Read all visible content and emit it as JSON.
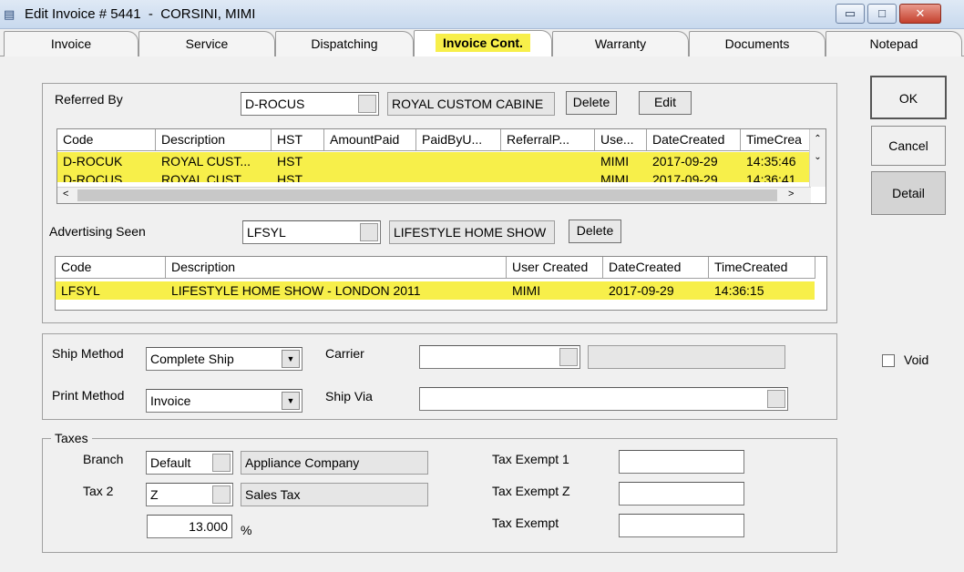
{
  "window": {
    "title": "Edit Invoice # 5441  -  CORSINI, MIMI",
    "min_glyph": "▭",
    "max_glyph": "□",
    "close_glyph": "✕"
  },
  "tabs": [
    "Invoice",
    "Service",
    "Dispatching",
    "Invoice Cont.",
    "Warranty",
    "Documents",
    "Notepad"
  ],
  "referred_by": {
    "label": "Referred By",
    "code": "D-ROCUS",
    "description": "ROYAL CUSTOM CABINE",
    "delete_label": "Delete",
    "edit_label": "Edit",
    "columns": [
      "Code",
      "Description",
      "HST",
      "AmountPaid",
      "PaidByU...",
      "ReferralP...",
      "Use...",
      "DateCreated",
      "TimeCrea"
    ],
    "rows": [
      {
        "code": "D-ROCUK",
        "description": "ROYAL CUST...",
        "hst": "HST",
        "user": "MIMI",
        "date": "2017-09-29",
        "time": "14:35:46"
      },
      {
        "code": "D-ROCUS",
        "description": "ROYAL CUST...",
        "hst": "HST",
        "user": "MIMI",
        "date": "2017-09-29",
        "time": "14:36:41"
      }
    ]
  },
  "advertising": {
    "label": "Advertising Seen",
    "code": "LFSYL",
    "description": "LIFESTYLE HOME SHOW",
    "delete_label": "Delete",
    "columns": [
      "Code",
      "Description",
      "User Created",
      "DateCreated",
      "TimeCreated"
    ],
    "rows": [
      {
        "code": "LFSYL",
        "description": "LIFESTYLE HOME SHOW - LONDON 2011",
        "user": "MIMI",
        "date": "2017-09-29",
        "time": "14:36:15"
      }
    ]
  },
  "shipping": {
    "ship_method_label": "Ship Method",
    "ship_method_value": "Complete Ship",
    "carrier_label": "Carrier",
    "carrier_value": "",
    "print_method_label": "Print Method",
    "print_method_value": "Invoice",
    "ship_via_label": "Ship Via",
    "ship_via_value": ""
  },
  "taxes": {
    "legend": "Taxes",
    "branch_label": "Branch",
    "branch_value": "Default",
    "branch_desc": "Appliance Company",
    "tax2_label": "Tax 2",
    "tax2_value": "Z",
    "tax2_desc": "Sales Tax",
    "rate_value": "13.000",
    "percent_sign": "%",
    "exempt1_label": "Tax Exempt 1",
    "exempt1_value": "",
    "exemptz_label": "Tax Exempt Z",
    "exemptz_value": "",
    "exempt_label": "Tax Exempt",
    "exempt_value": ""
  },
  "actions": {
    "ok_label": "OK",
    "cancel_label": "Cancel",
    "detail_label": "Detail",
    "void_label": "Void"
  }
}
